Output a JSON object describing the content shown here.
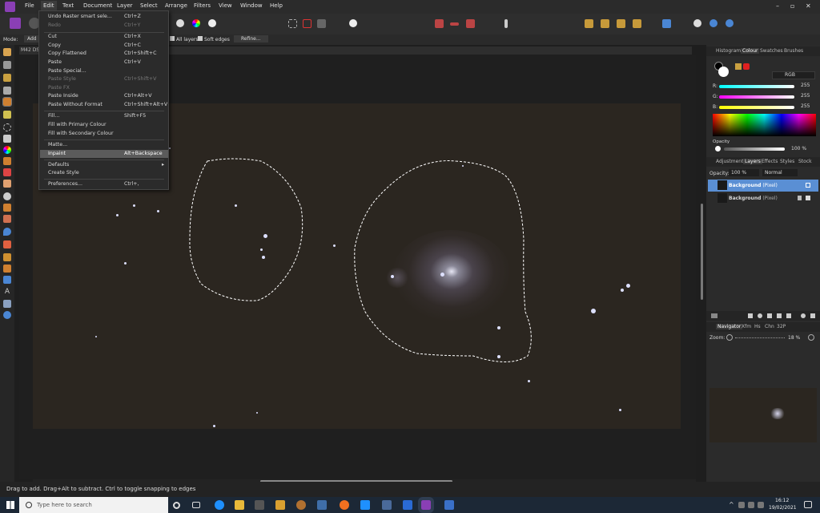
{
  "menubar": {
    "items": [
      "File",
      "Edit",
      "Text",
      "Document",
      "Layer",
      "Select",
      "Arrange",
      "Filters",
      "View",
      "Window",
      "Help"
    ]
  },
  "context_bar": {
    "mode_label": "Mode:",
    "mode_value": "Add",
    "all_layers": "All layers",
    "soft_edges": "Soft edges",
    "refine": "Refine..."
  },
  "document_tab": "M42 DSS",
  "edit_menu": {
    "items": [
      {
        "label": "Undo Raster smart sele...",
        "shortcut": "Ctrl+Z",
        "disabled": false
      },
      {
        "label": "Redo",
        "shortcut": "Ctrl+Y",
        "disabled": true
      },
      {
        "label": "Cut",
        "shortcut": "Ctrl+X",
        "disabled": false
      },
      {
        "label": "Copy",
        "shortcut": "Ctrl+C",
        "disabled": false
      },
      {
        "label": "Copy Flattened",
        "shortcut": "Ctrl+Shift+C",
        "disabled": false
      },
      {
        "label": "Paste",
        "shortcut": "Ctrl+V",
        "disabled": false
      },
      {
        "label": "Paste Special...",
        "shortcut": "",
        "disabled": false
      },
      {
        "label": "Paste Style",
        "shortcut": "Ctrl+Shift+V",
        "disabled": true
      },
      {
        "label": "Paste FX",
        "shortcut": "",
        "disabled": true
      },
      {
        "label": "Paste Inside",
        "shortcut": "Ctrl+Alt+V",
        "disabled": false
      },
      {
        "label": "Paste Without Format",
        "shortcut": "Ctrl+Shift+Alt+V",
        "disabled": false
      },
      {
        "label": "Fill...",
        "shortcut": "Shift+F5",
        "disabled": false
      },
      {
        "label": "Fill with Primary Colour",
        "shortcut": "",
        "disabled": false
      },
      {
        "label": "Fill with Secondary Colour",
        "shortcut": "",
        "disabled": false
      },
      {
        "label": "Matte...",
        "shortcut": "",
        "disabled": false
      },
      {
        "label": "Inpaint",
        "shortcut": "Alt+Backspace",
        "disabled": false
      },
      {
        "label": "Defaults",
        "shortcut": "",
        "disabled": false
      },
      {
        "label": "Create Style",
        "shortcut": "",
        "disabled": false
      },
      {
        "label": "Preferences...",
        "shortcut": "Ctrl+,",
        "disabled": false
      }
    ],
    "highlighted": "Inpaint"
  },
  "colour_panel": {
    "tabs": [
      "Histogram",
      "Colour",
      "Swatches",
      "Brushes"
    ],
    "active_tab": "Colour",
    "mode": "RGB",
    "r_label": "R:",
    "r_value": "255",
    "g_label": "G:",
    "g_value": "255",
    "b_label": "B:",
    "b_value": "255",
    "opacity_label": "Opacity",
    "opacity_value": "100 %"
  },
  "layers_panel": {
    "tabs": [
      "Adjustment",
      "Layers",
      "Effects",
      "Styles",
      "Stock"
    ],
    "active_tab": "Layers",
    "opacity_label": "Opacity:",
    "opacity_value": "100 %",
    "blend_mode": "Normal",
    "layers": [
      {
        "name": "Background",
        "type": "(Pixel)",
        "selected": true
      },
      {
        "name": "Background",
        "type": "(Pixel)",
        "selected": false
      }
    ]
  },
  "navigator_panel": {
    "tabs": [
      "Navigator",
      "Xfm",
      "Hs",
      "Chn",
      "32P"
    ],
    "active_tab": "Navigator",
    "zoom_label": "Zoom:",
    "zoom_value": "18 %"
  },
  "status_bar": {
    "text": "Drag to add. Drag+Alt to subtract. Ctrl to toggle snapping to edges"
  },
  "taskbar": {
    "search_placeholder": "Type here to search",
    "time": "16:12",
    "date": "19/02/2021"
  },
  "colors": {
    "accent": "#5a8fd4",
    "brand": "#8a3fb5",
    "canvas": "#2b2620"
  }
}
